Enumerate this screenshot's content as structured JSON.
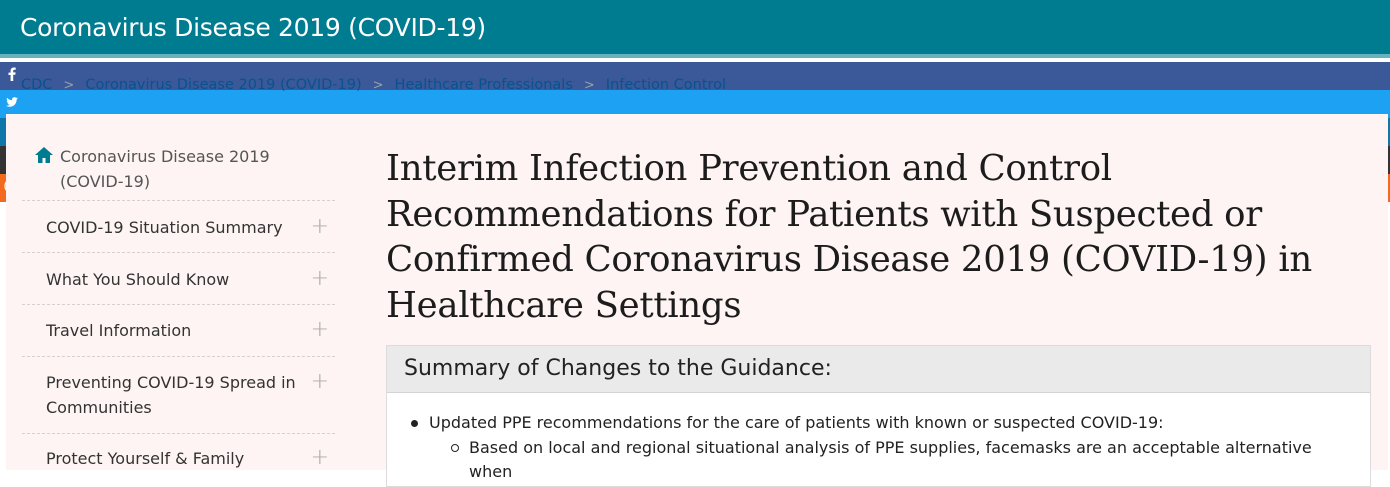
{
  "site": {
    "title": "Coronavirus Disease 2019 (COVID-19)"
  },
  "breadcrumb": [
    "CDC",
    "Coronavirus Disease 2019 (COVID-19)",
    "Healthcare Professionals",
    "Infection Control"
  ],
  "breadcrumb_separator": ">",
  "social": [
    {
      "name": "facebook-icon",
      "color": "#3b5998"
    },
    {
      "name": "twitter-icon",
      "color": "#1da1f2"
    },
    {
      "name": "linkedin-icon",
      "color": "#0e76a8"
    },
    {
      "name": "email-icon",
      "color": "#333333"
    },
    {
      "name": "syndicate-icon",
      "color": "#f36a1e"
    }
  ],
  "sidebar": {
    "home": "Coronavirus Disease 2019 (COVID-19)",
    "items": [
      {
        "label": "COVID-19 Situation Summary",
        "toggle": "+"
      },
      {
        "label": "What You Should Know",
        "toggle": "+"
      },
      {
        "label": "Travel Information",
        "toggle": "+"
      },
      {
        "label": "Preventing COVID-19 Spread in Communities",
        "toggle": "+"
      },
      {
        "label": "Protect Yourself & Family",
        "toggle": "+"
      }
    ]
  },
  "page": {
    "title": "Interim Infection Prevention and Control Recommendations for Patients with Suspected or Confirmed Coronavirus Disease 2019 (COVID-19) in Healthcare Settings"
  },
  "summary": {
    "heading": "Summary of Changes to the Guidance:",
    "bullet": "Updated PPE recommendations for the care of patients with known or suspected COVID-19:",
    "sub_bullet": "Based on local and regional situational analysis of PPE supplies, facemasks are an acceptable alternative when"
  }
}
